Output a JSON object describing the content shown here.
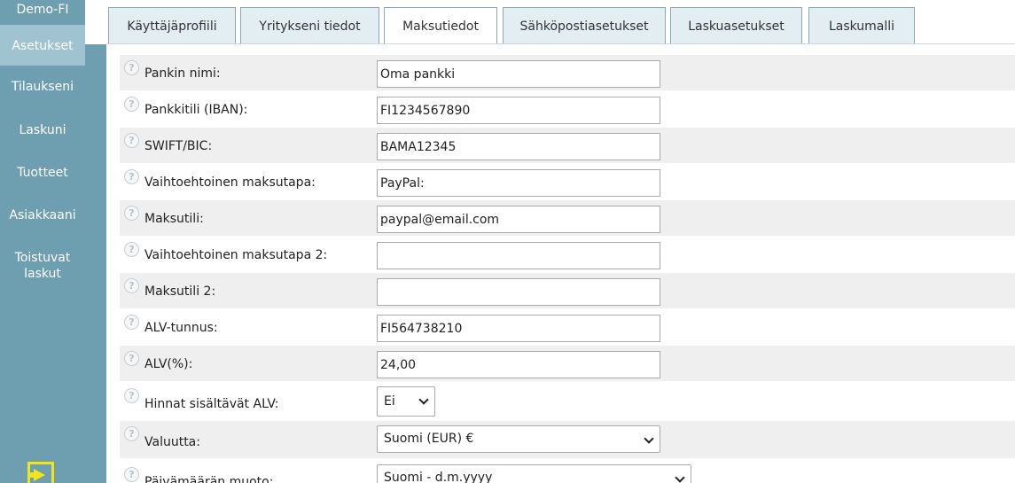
{
  "app": {
    "brand": "Demo-FI"
  },
  "sidebar": {
    "items": [
      {
        "label": "Asetukset",
        "active": true
      },
      {
        "label": "Tilaukseni"
      },
      {
        "label": "Laskuni"
      },
      {
        "label": "Tuotteet"
      },
      {
        "label": "Asiakkaani"
      },
      {
        "label": "Toistuvat laskut"
      }
    ],
    "exit_icon": "exit-icon"
  },
  "tabs": [
    {
      "label": "Käyttäjäprofiili"
    },
    {
      "label": "Yritykseni tiedot"
    },
    {
      "label": "Maksutiedot",
      "active": true
    },
    {
      "label": "Sähköpostiasetukset"
    },
    {
      "label": "Laskuasetukset"
    },
    {
      "label": "Laskumalli"
    }
  ],
  "form": {
    "help_glyph": "?",
    "fields": [
      {
        "label": "Pankin nimi:",
        "value": "Oma pankki"
      },
      {
        "label": "Pankkitili (IBAN):",
        "value": "FI1234567890"
      },
      {
        "label": "SWIFT/BIC:",
        "value": "BAMA12345"
      },
      {
        "label": "Vaihtoehtoinen maksutapa:",
        "value": "PayPal:"
      },
      {
        "label": "Maksutili:",
        "value": "paypal@email.com"
      },
      {
        "label": "Vaihtoehtoinen maksutapa 2:",
        "value": ""
      },
      {
        "label": "Maksutili 2:",
        "value": ""
      },
      {
        "label": "ALV-tunnus:",
        "value": "FI564738210"
      },
      {
        "label": "ALV(%):",
        "value": "24,00"
      }
    ],
    "vat_included": {
      "label": "Hinnat sisältävät ALV:",
      "value": "Ei"
    },
    "currency": {
      "label": "Valuutta:",
      "value": "Suomi (EUR) €"
    },
    "date_format": {
      "label": "Päivämäärän muoto:",
      "value": "Suomi - d.m.yyyy"
    }
  }
}
